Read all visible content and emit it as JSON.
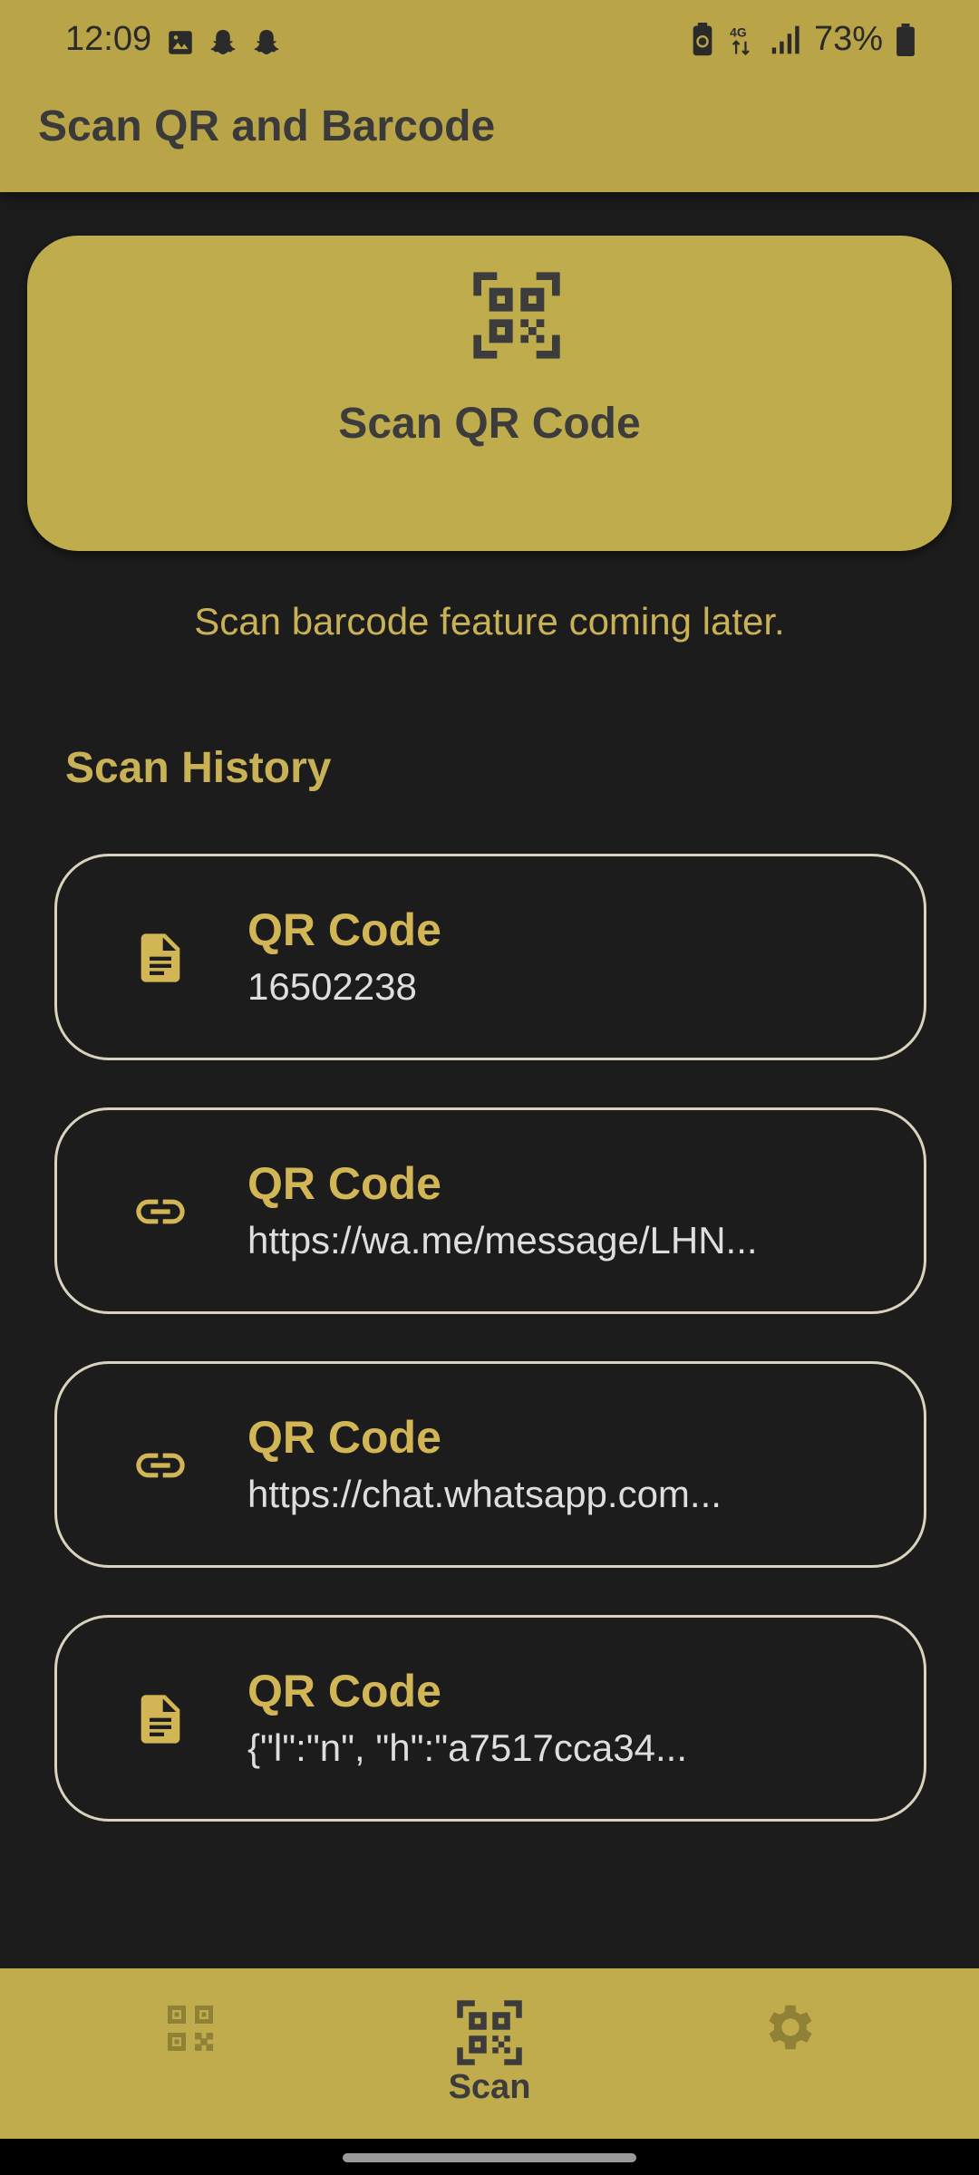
{
  "status_bar": {
    "time": "12:09",
    "network": "4G",
    "battery": "73%",
    "left_icons": [
      "image-icon",
      "snapchat-icon",
      "snapchat-icon"
    ],
    "right_icons": [
      "battery-saver-icon",
      "4g-data-icon",
      "signal-icon",
      "battery-icon"
    ]
  },
  "app_bar": {
    "title": "Scan QR and Barcode"
  },
  "scan_card": {
    "icon": "qr-scanner-icon",
    "label": "Scan QR Code"
  },
  "notice": "Scan barcode feature coming later.",
  "history": {
    "title": "Scan History",
    "items": [
      {
        "icon": "document-icon",
        "type": "QR Code",
        "value": "16502238"
      },
      {
        "icon": "link-icon",
        "type": "QR Code",
        "value": "https://wa.me/message/LHN..."
      },
      {
        "icon": "link-icon",
        "type": "QR Code",
        "value": "https://chat.whatsapp.com..."
      },
      {
        "icon": "document-icon",
        "type": "QR Code",
        "value": "{\"l\":\"n\", \"h\":\"a7517cca34..."
      }
    ]
  },
  "bottom_nav": {
    "items": [
      {
        "icon": "qr-code-icon",
        "label": "",
        "active": false
      },
      {
        "icon": "qr-scanner-icon",
        "label": "Scan",
        "active": true
      },
      {
        "icon": "gear-icon",
        "label": "",
        "active": false
      }
    ]
  },
  "colors": {
    "accent": "#c0ac4d",
    "background": "#1c1c1c",
    "accent_text": "#d2b656",
    "outline": "#d9d3bd"
  }
}
